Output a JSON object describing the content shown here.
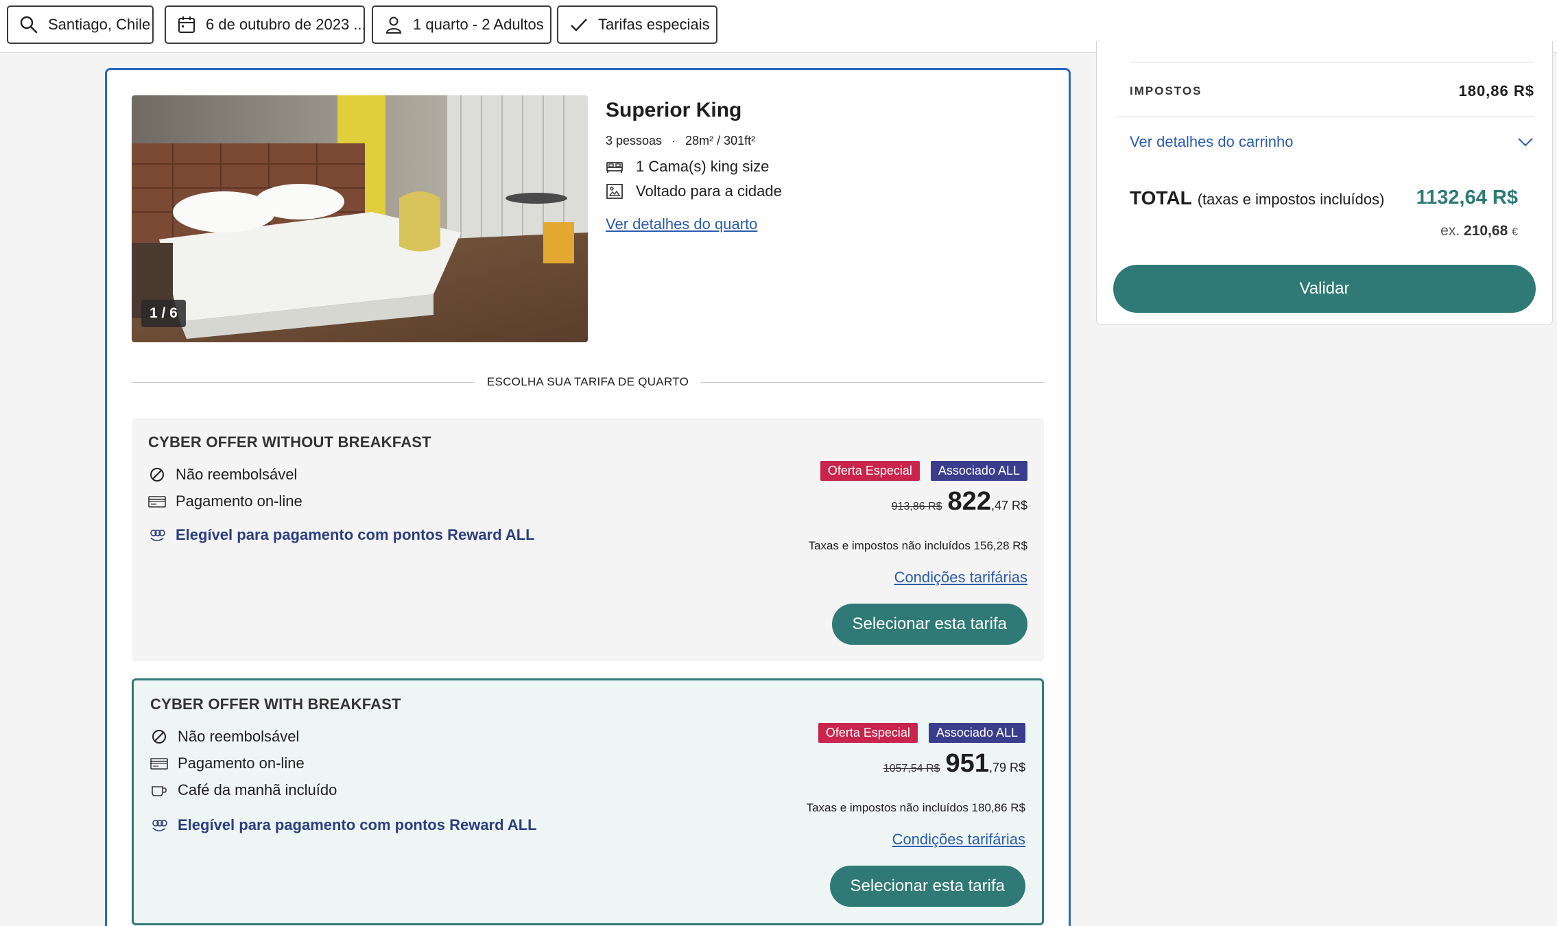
{
  "filters": {
    "destination": "Santiago, Chile",
    "date": "6 de outubro de 2023 ...",
    "occupancy": "1 quarto - 2 Adultos",
    "special_rates": "Tarifas especiais"
  },
  "room": {
    "photo_counter": "1 / 6",
    "title": "Superior King",
    "capacity": "3 pessoas",
    "separator": "·",
    "size": "28m² / 301ft²",
    "bed": "1 Cama(s) king size",
    "view": "Voltado para a cidade",
    "details_link": "Ver detalhes do quarto",
    "choose_rate": "ESCOLHA SUA TARIFA DE QUARTO"
  },
  "rates": [
    {
      "title": "CYBER OFFER WITHOUT BREAKFAST",
      "refund": "Não reembolsável",
      "payment": "Pagamento on-line",
      "reward": "Elegível para pagamento com pontos Reward ALL",
      "badge_special": "Oferta Especial",
      "badge_member": "Associado ALL",
      "old_price": "913,86 R$",
      "price_int": "822",
      "price_dec": ",47 R$",
      "taxes": "Taxas e impostos não incluídos 156,28 R$",
      "conditions": "Condições tarifárias",
      "select": "Selecionar esta tarifa"
    },
    {
      "title": "CYBER OFFER WITH BREAKFAST",
      "refund": "Não reembolsável",
      "payment": "Pagamento on-line",
      "breakfast": "Café da manhã incluído",
      "reward": "Elegível para pagamento com pontos Reward ALL",
      "badge_special": "Oferta Especial",
      "badge_member": "Associado ALL",
      "old_price": "1057,54 R$",
      "price_int": "951",
      "price_dec": ",79 R$",
      "taxes": "Taxas e impostos não incluídos 180,86 R$",
      "conditions": "Condições tarifárias",
      "select": "Selecionar esta tarifa"
    }
  ],
  "summary": {
    "tax_label": "IMPOSTOS",
    "tax_value": "180,86 R$",
    "cart_link": "Ver detalhes do carrinho",
    "total_label": "TOTAL",
    "total_note": "(taxas e impostos incluídos)",
    "total_value": "1132,64 R$",
    "ex_prefix": "ex.",
    "ex_value": "210,68",
    "ex_currency": "€",
    "validate": "Validar"
  },
  "colors": {
    "accent": "#2f7a76",
    "link": "#2a5cad",
    "card_border": "#2b67c4",
    "special_badge": "#c8244c",
    "member_badge": "#3a3d8c",
    "reward_text": "#2c3e80"
  }
}
